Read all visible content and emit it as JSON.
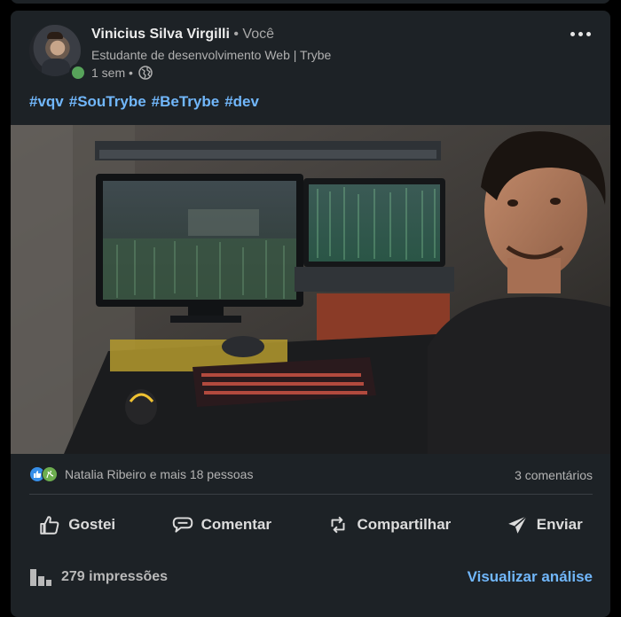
{
  "post": {
    "author": {
      "name": "Vinicius Silva Virgilli",
      "relation": "• Você",
      "headline": "Estudante de desenvolvimento Web | Trybe",
      "time": "1 sem •"
    },
    "hashtags": [
      "#vqv",
      "#SouTrybe",
      "#BeTrybe",
      "#dev"
    ],
    "reactions": {
      "summary": "Natalia Ribeiro e mais 18 pessoas",
      "comments": "3 comentários"
    },
    "actions": {
      "like": "Gostei",
      "comment": "Comentar",
      "share": "Compartilhar",
      "send": "Enviar"
    },
    "footer": {
      "impressions": "279 impressões",
      "analytics": "Visualizar análise"
    }
  },
  "colors": {
    "card_bg": "#1d2226",
    "link": "#71b7fb",
    "online": "#57a35a",
    "like": "#378fe9",
    "celebrate": "#6dae4f"
  }
}
